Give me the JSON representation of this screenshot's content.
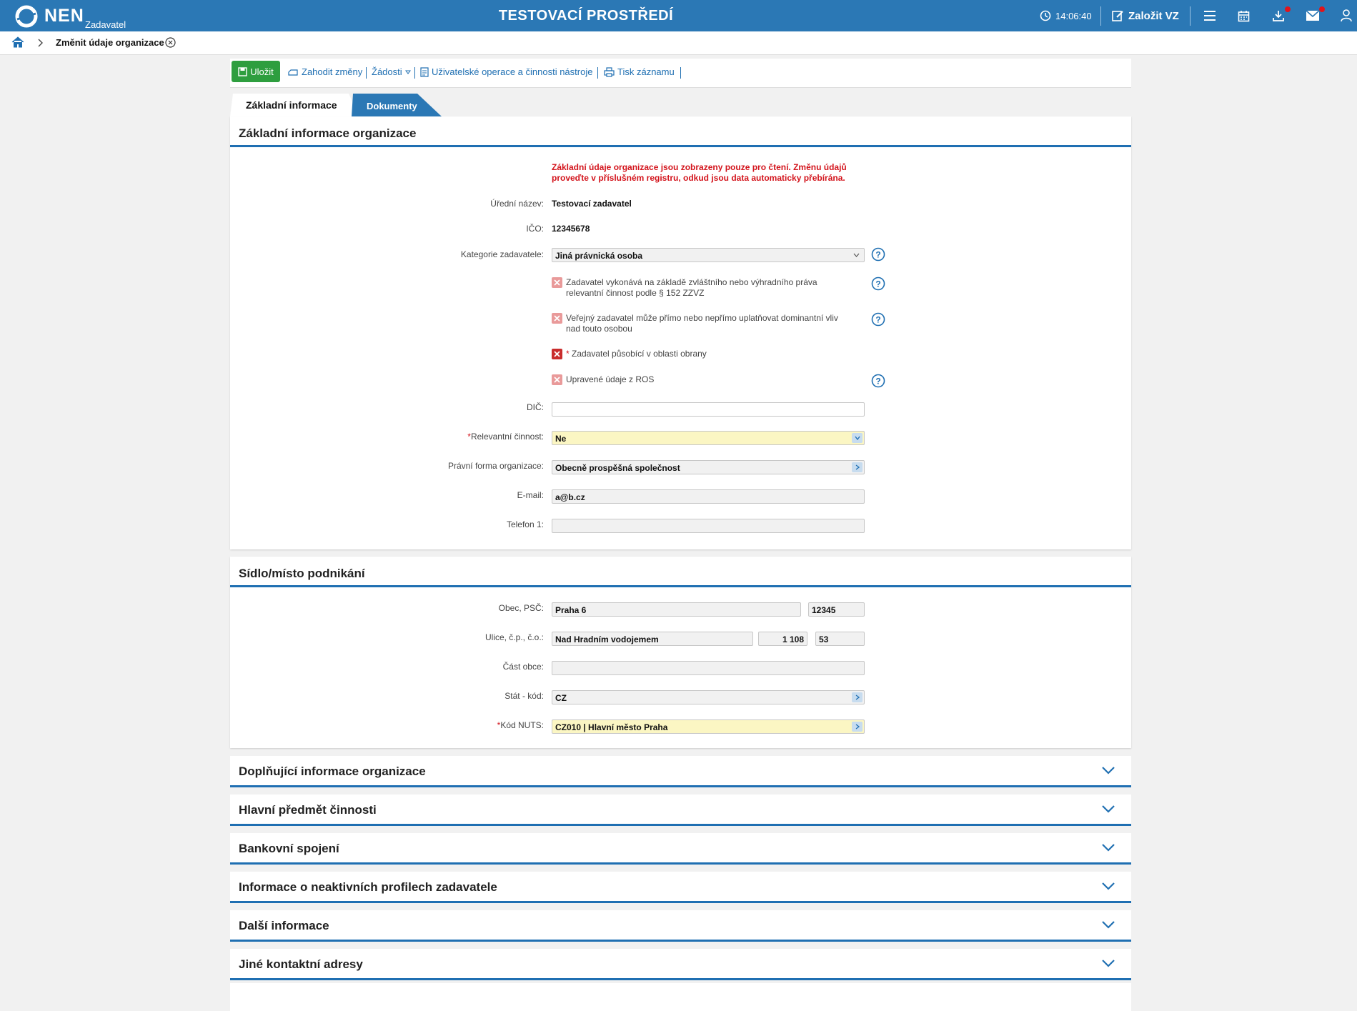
{
  "topbar": {
    "logo_text": "NEN",
    "logo_sub": "Zadavatel",
    "env_title": "TESTOVACÍ PROSTŘEDÍ",
    "time": "14:06:40",
    "create_label": "Založit VZ"
  },
  "breadcrumb": {
    "current": "Změnit údaje organizace"
  },
  "toolbar": {
    "save": "Uložit",
    "discard": "Zahodit změny",
    "requests": "Žádosti",
    "user_ops": "Uživatelské operace a činnosti nástroje",
    "print": "Tisk záznamu"
  },
  "tabs": {
    "basic": "Základní informace",
    "documents": "Dokumenty"
  },
  "basic": {
    "title": "Základní informace organizace",
    "warning_line1": "Základní údaje organizace jsou zobrazeny pouze pro čtení. Změnu údajů",
    "warning_line2": "proveďte v příslušném registru, odkud jsou data automaticky přebírána.",
    "official_name_label": "Úřední název:",
    "official_name": "Testovací zadavatel",
    "ico_label": "IČO:",
    "ico": "12345678",
    "category_label": "Kategorie zadavatele:",
    "category": "Jiná právnická osoba",
    "cb1_line1": "Zadavatel vykonává na základě zvláštního nebo výhradního práva",
    "cb1_line2": "relevantní činnost podle § 152 ZZVZ",
    "cb2_line1": "Veřejný zadavatel může přímo nebo nepřímo uplatňovat dominantní vliv",
    "cb2_line2": "nad touto osobou",
    "cb3_required": "*",
    "cb3": "Zadavatel působící v oblasti obrany",
    "cb4": "Upravené údaje z ROS",
    "dic_label": "DIČ:",
    "dic": "",
    "relevant_required": "*",
    "relevant_label": "Relevantní činnost:",
    "relevant": "Ne",
    "legal_form_label": "Právní forma organizace:",
    "legal_form": "Obecně prospěšná společnost",
    "email_label": "E-mail:",
    "email": "a@b.cz",
    "phone_label": "Telefon 1:",
    "phone": ""
  },
  "address": {
    "title": "Sídlo/místo podnikání",
    "city_label": "Obec, PSČ:",
    "city": "Praha 6",
    "zip": "12345",
    "street_label": "Ulice, č.p., č.o.:",
    "street": "Nad Hradním vodojemem",
    "cp": "1 108",
    "co": "53",
    "part_label": "Část obce:",
    "part": "",
    "country_label": "Stát - kód:",
    "country": "CZ",
    "nuts_required": "*",
    "nuts_label": "Kód NUTS:",
    "nuts": "CZ010 | Hlavní město Praha"
  },
  "collapsed_sections": [
    "Doplňující informace organizace",
    "Hlavní předmět činnosti",
    "Bankovní spojení",
    "Informace o neaktivních profilech zadavatele",
    "Další informace",
    "Jiné kontaktní adresy"
  ],
  "colors": {
    "header_blue": "#2b78b5",
    "accent_blue": "#1f6fb2",
    "save_green": "#2e9e3f",
    "warning_red": "#d3141c",
    "required_yellow": "#fbf6c3"
  }
}
